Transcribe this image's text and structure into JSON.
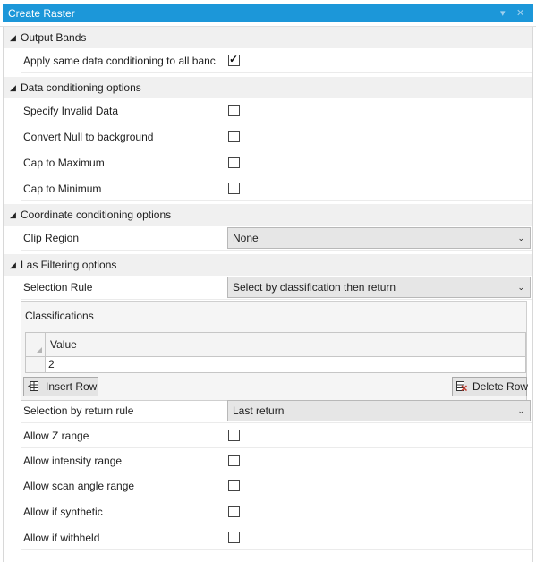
{
  "window": {
    "title": "Create Raster",
    "pin_glyph": "▾",
    "close_glyph": "✕"
  },
  "sections": {
    "output_bands": "Output Bands",
    "data_conditioning": "Data conditioning options",
    "coordinate_conditioning": "Coordinate conditioning options",
    "las_filtering": "Las Filtering options"
  },
  "rows": {
    "apply_same": {
      "label": "Apply same data conditioning to all banc",
      "checked": true
    },
    "specify_invalid": {
      "label": "Specify Invalid Data",
      "checked": false
    },
    "convert_null": {
      "label": "Convert Null to background",
      "checked": false
    },
    "cap_max": {
      "label": "Cap to Maximum",
      "checked": false
    },
    "cap_min": {
      "label": "Cap to Minimum",
      "checked": false
    },
    "clip_region": {
      "label": "Clip Region",
      "value": "None"
    },
    "selection_rule": {
      "label": "Selection Rule",
      "value": "Select by classification then return"
    },
    "return_rule": {
      "label": "Selection by return rule",
      "value": "Last return"
    },
    "allow_z": {
      "label": "Allow Z range",
      "checked": false
    },
    "allow_intensity": {
      "label": "Allow intensity range",
      "checked": false
    },
    "allow_scan": {
      "label": "Allow scan angle range",
      "checked": false
    },
    "allow_synthetic": {
      "label": "Allow if synthetic",
      "checked": false
    },
    "allow_withheld": {
      "label": "Allow if withheld",
      "checked": false
    }
  },
  "classifications": {
    "title": "Classifications",
    "column": "Value",
    "values": [
      "2"
    ],
    "insert_row": "Insert Row",
    "delete_row": "Delete Row"
  },
  "glyphs": {
    "collapse": "◢",
    "dropdown": "⌄",
    "check": "✓"
  }
}
